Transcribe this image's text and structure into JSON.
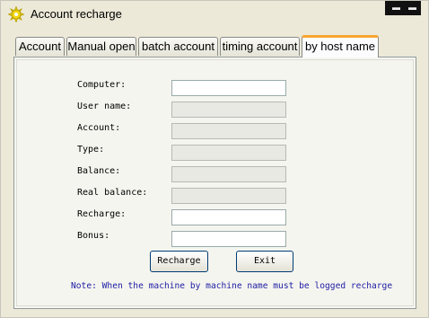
{
  "window": {
    "title": "Account recharge",
    "icon": "sun-gear-icon"
  },
  "tabs": [
    {
      "label": "Account"
    },
    {
      "label": "Manual open"
    },
    {
      "label": "batch account"
    },
    {
      "label": "timing account"
    },
    {
      "label": "by host name",
      "active": true
    }
  ],
  "form": {
    "fields": [
      {
        "label": "Computer:",
        "value": "",
        "editable": true
      },
      {
        "label": "User name:",
        "value": "",
        "editable": false
      },
      {
        "label": "Account:",
        "value": "",
        "editable": false
      },
      {
        "label": "Type:",
        "value": "",
        "editable": false
      },
      {
        "label": "Balance:",
        "value": "",
        "editable": false
      },
      {
        "label": "Real balance:",
        "value": "",
        "editable": false
      },
      {
        "label": "Recharge:",
        "value": "",
        "editable": true
      },
      {
        "label": "Bonus:",
        "value": "",
        "editable": true
      }
    ],
    "recharge_button": "Recharge",
    "exit_button": "Exit",
    "note": "Note: When the machine by machine name must be logged recharge"
  },
  "colors": {
    "active_tab_accent": "#f7a532",
    "note_text": "#1c1ca4",
    "background": "#ece9d8"
  }
}
